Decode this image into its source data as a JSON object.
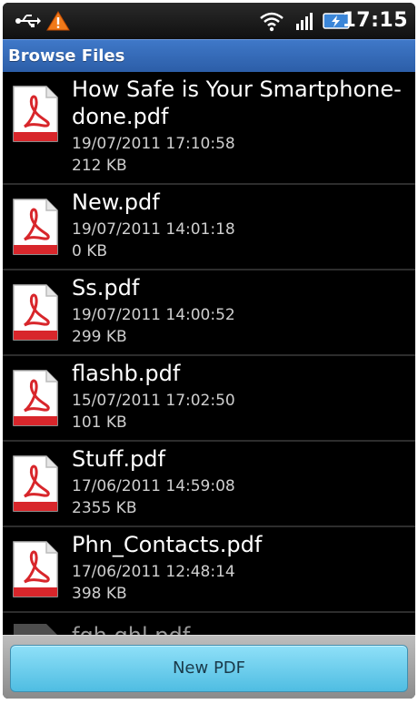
{
  "status_bar": {
    "time": "17:15",
    "icons": [
      "usb-icon",
      "warning-icon",
      "wifi-icon",
      "signal-icon",
      "battery-charging-icon"
    ]
  },
  "title_bar": {
    "title": "Browse Files"
  },
  "files": [
    {
      "name": "How Safe is Your Smartphone-done.pdf",
      "date": "19/07/2011 17:10:58",
      "size": "212 KB"
    },
    {
      "name": "New.pdf",
      "date": "19/07/2011 14:01:18",
      "size": "0 KB"
    },
    {
      "name": "Ss.pdf",
      "date": "19/07/2011 14:00:52",
      "size": "299 KB"
    },
    {
      "name": "flashb.pdf",
      "date": "15/07/2011 17:02:50",
      "size": "101 KB"
    },
    {
      "name": "Stuff.pdf",
      "date": "17/06/2011 14:59:08",
      "size": "2355 KB"
    },
    {
      "name": "Phn_Contacts.pdf",
      "date": "17/06/2011 12:48:14",
      "size": "398 KB"
    },
    {
      "name": "fgh ghl.pdf"
    }
  ],
  "colors": {
    "title_bar": "#2c5ea8",
    "button": "#4fbde2",
    "pdf_red": "#d8262b"
  },
  "bottom_bar": {
    "new_pdf_label": "New PDF"
  }
}
